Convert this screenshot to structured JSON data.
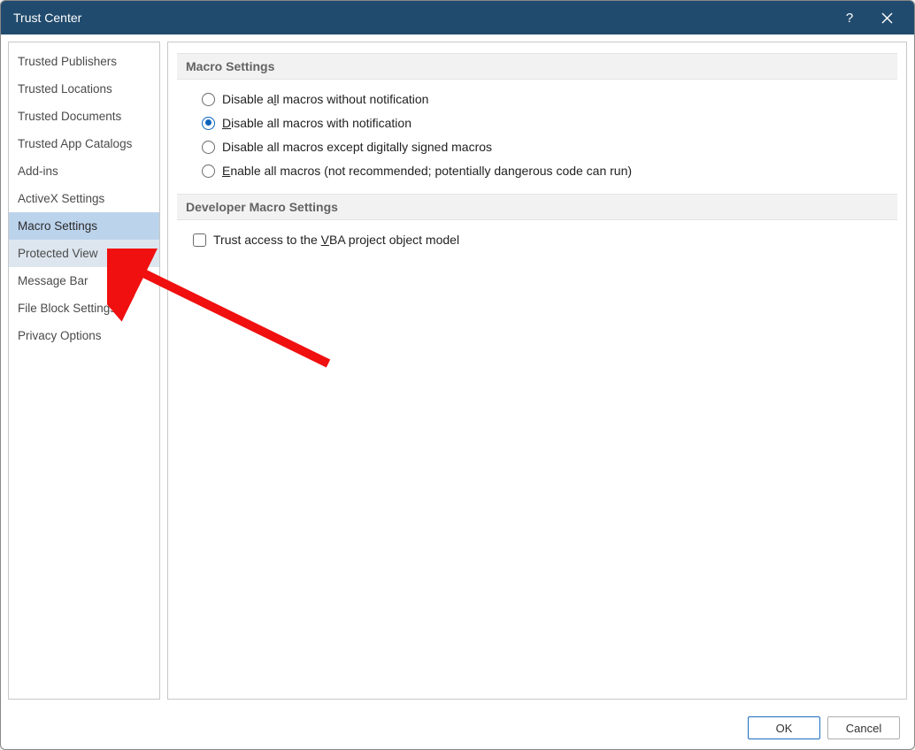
{
  "titlebar": {
    "title": "Trust Center"
  },
  "sidebar": {
    "items": [
      {
        "label": "Trusted Publishers"
      },
      {
        "label": "Trusted Locations"
      },
      {
        "label": "Trusted Documents"
      },
      {
        "label": "Trusted App Catalogs"
      },
      {
        "label": "Add-ins"
      },
      {
        "label": "ActiveX Settings"
      },
      {
        "label": "Macro Settings"
      },
      {
        "label": "Protected View"
      },
      {
        "label": "Message Bar"
      },
      {
        "label": "File Block Settings"
      },
      {
        "label": "Privacy Options"
      }
    ]
  },
  "content": {
    "section1_title": "Macro Settings",
    "radios": [
      {
        "pre": "Disable a",
        "u": "l",
        "post": "l macros without notification"
      },
      {
        "pre": "",
        "u": "D",
        "post": "isable all macros with notification"
      },
      {
        "pre": "Disable all macros except di",
        "u": "g",
        "post": "itally signed macros"
      },
      {
        "pre": "",
        "u": "E",
        "post": "nable all macros (not recommended; potentially dangerous code can run)"
      }
    ],
    "section2_title": "Developer Macro Settings",
    "checkbox": {
      "pre": "Trust access to the ",
      "u": "V",
      "post": "BA project object model"
    }
  },
  "footer": {
    "ok": "OK",
    "cancel": "Cancel"
  }
}
